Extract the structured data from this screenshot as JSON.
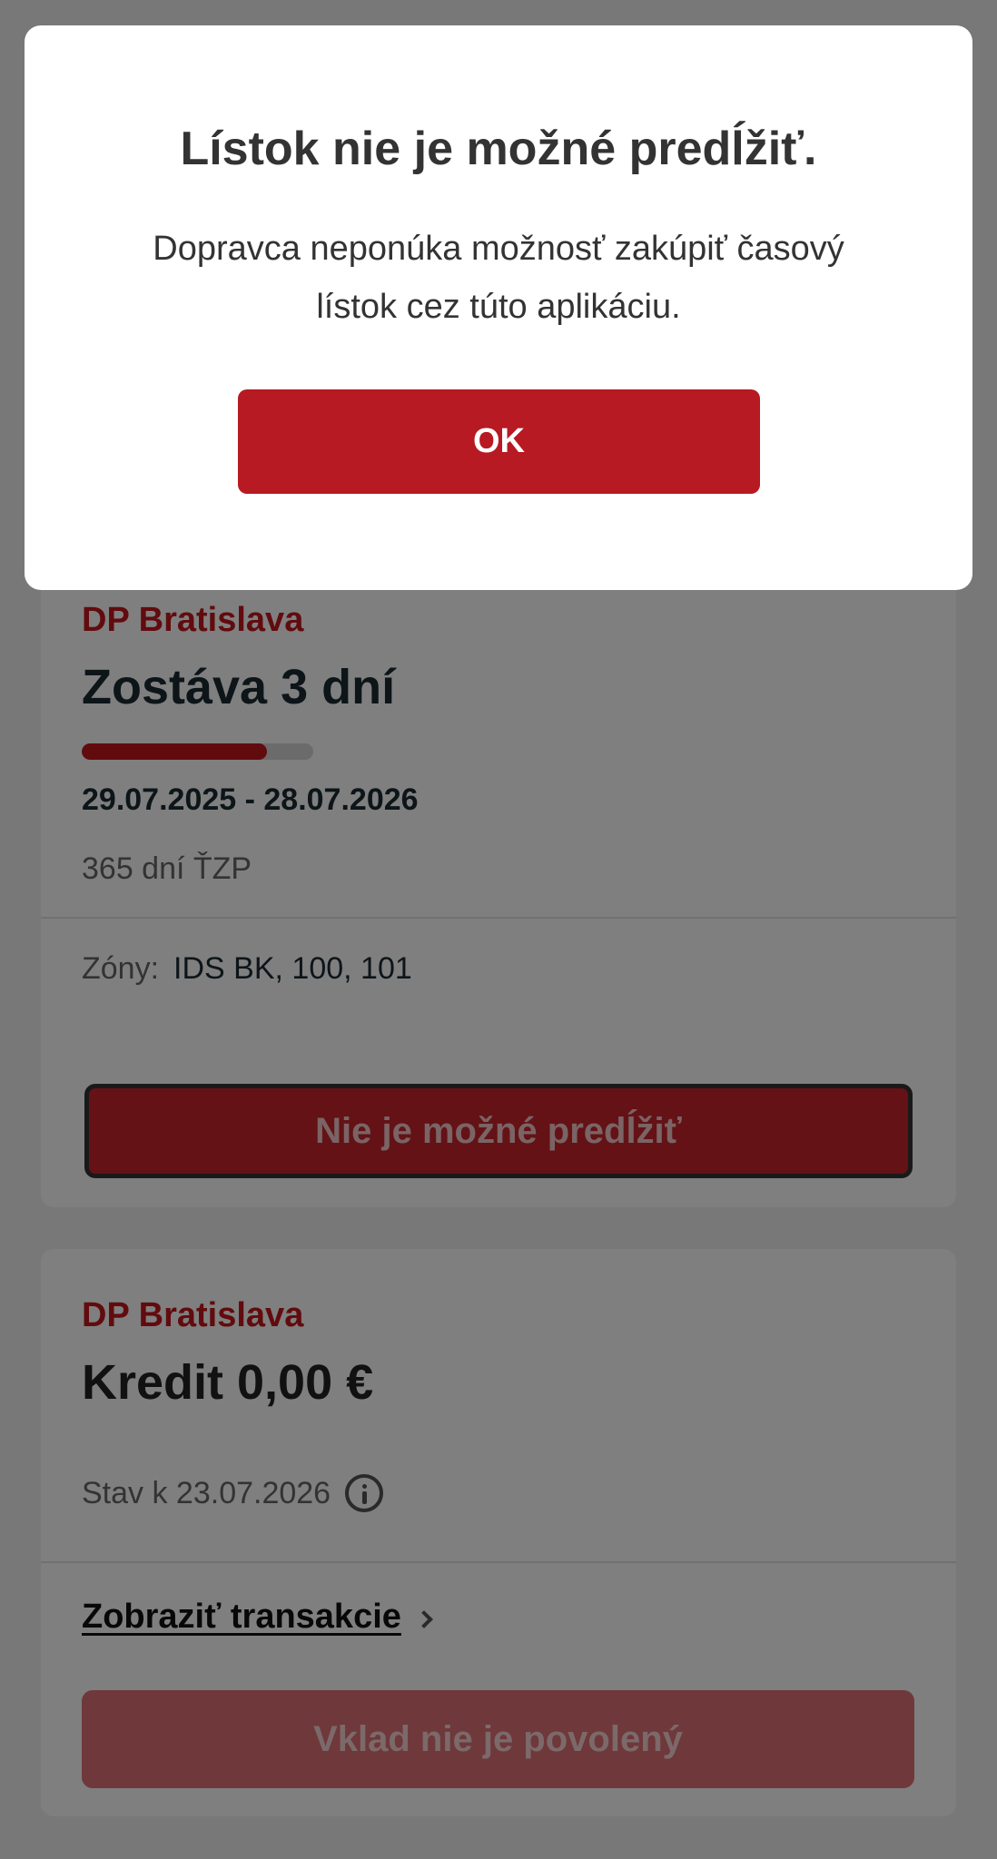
{
  "dialog": {
    "title": "Lístok nie je možné predĺžiť.",
    "message": "Dopravca neponúka možnosť zakúpiť časový lístok cez túto aplikáciu.",
    "ok_label": "OK"
  },
  "period_ticket": {
    "carrier": "DP Bratislava",
    "remaining": "Zostáva 3 dní",
    "remaining_fraction": 0.8,
    "date_range": "29.07.2025 - 28.07.2026",
    "ticket_type": "365 dní ŤZP",
    "zones_label": "Zóny:",
    "zones_value": "IDS BK, 100, 101",
    "renew_button_label": "Nie je možné predĺžiť"
  },
  "credit": {
    "carrier": "DP Bratislava",
    "amount": "Kredit 0,00 €",
    "status": "Stav k 23.07.2026",
    "transactions_link": "Zobraziť transakcie",
    "deposit_button_label": "Vklad nie je povolený"
  },
  "colors": {
    "brand_red": "#c4161c",
    "ok_button": "#b71a22",
    "scrim": "rgba(0,0,0,0.5)"
  },
  "icons": {
    "info": "info-icon",
    "chevron": "chevron-right-icon"
  }
}
